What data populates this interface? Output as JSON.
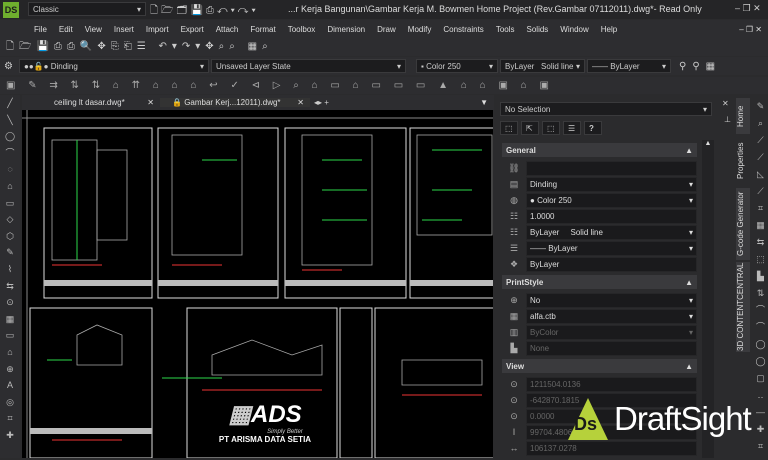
{
  "title_bar": {
    "workspace": "Classic",
    "title": "...r Kerja Bangunan\\Gambar Kerja M. Bowmen Home Project (Rev.Gambar 07112011).dwg*- Read Only"
  },
  "menu": [
    "File",
    "Edit",
    "View",
    "Insert",
    "Import",
    "Export",
    "Attach",
    "Format",
    "Toolbox",
    "Dimension",
    "Draw",
    "Modify",
    "Constraints",
    "Tools",
    "Solids",
    "Window",
    "Help"
  ],
  "layer_bar": {
    "layer": "Dinding",
    "layer_state": "Unsaved Layer State",
    "color": "Color 250",
    "linestyle_by": "ByLayer",
    "linestyle": "Solid line",
    "lineweight": "ByLayer"
  },
  "tabs": [
    {
      "label": "ceiling lt dasar.dwg*"
    },
    {
      "label": "Gambar Kerj...12011).dwg*"
    }
  ],
  "properties": {
    "selection": "No Selection",
    "general": {
      "title": "General",
      "layer": "Dinding",
      "color": "Color 250",
      "scale": "1.0000",
      "linestyle_by": "ByLayer",
      "linestyle": "Solid line",
      "lineweight": "ByLayer",
      "transparency": "ByLayer"
    },
    "printstyle": {
      "title": "PrintStyle",
      "value1": "No",
      "table": "alfa.ctb",
      "style": "ByColor",
      "value4": "None"
    },
    "view": {
      "title": "View",
      "cx": "1211504.0136",
      "cy": "-642870.1815",
      "cz": "0.0000",
      "height": "99704.4806",
      "width": "106137.0278"
    }
  },
  "side_tabs": [
    "Home",
    "Properties",
    "G-code Generator",
    "3D CONTENTCENTRAL"
  ],
  "watermark": {
    "ads": "ADS",
    "ads_tag": "Simply Better",
    "ads_company": "PT ARISMA DATA SETIA",
    "brand": "DraftSight"
  }
}
